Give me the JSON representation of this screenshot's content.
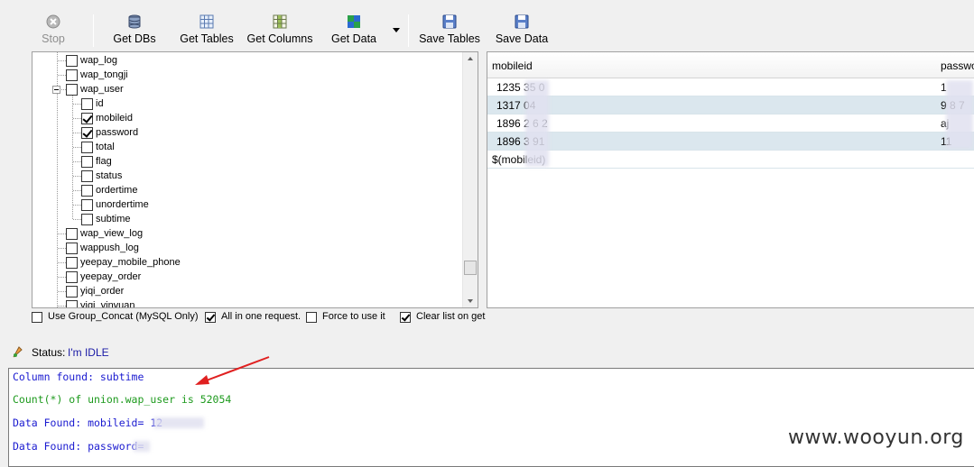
{
  "toolbar": {
    "stop": "Stop",
    "get_dbs": "Get DBs",
    "get_tables": "Get Tables",
    "get_columns": "Get Columns",
    "get_data": "Get Data",
    "save_tables": "Save Tables",
    "save_data": "Save Data"
  },
  "tree": {
    "items": [
      {
        "label": "wap_log",
        "checked": false
      },
      {
        "label": "wap_tongji",
        "checked": false
      },
      {
        "label": "wap_user",
        "checked": false,
        "expanded": true
      },
      {
        "label": "id",
        "checked": false
      },
      {
        "label": "mobileid",
        "checked": true
      },
      {
        "label": "password",
        "checked": true
      },
      {
        "label": "total",
        "checked": false
      },
      {
        "label": "flag",
        "checked": false
      },
      {
        "label": "status",
        "checked": false
      },
      {
        "label": "ordertime",
        "checked": false
      },
      {
        "label": "unordertime",
        "checked": false
      },
      {
        "label": "subtime",
        "checked": false
      },
      {
        "label": "wap_view_log",
        "checked": false
      },
      {
        "label": "wappush_log",
        "checked": false
      },
      {
        "label": "yeepay_mobile_phone",
        "checked": false
      },
      {
        "label": "yeepay_order",
        "checked": false
      },
      {
        "label": "yiqi_order",
        "checked": false
      },
      {
        "label": "yiqi_yinyuan",
        "checked": false
      }
    ]
  },
  "grid": {
    "columns": [
      "mobileid",
      "passwo"
    ],
    "rows": [
      [
        "1235    35    0",
        "1"
      ],
      [
        "1317    04    ",
        "9    8    7"
      ],
      [
        "1896    2    6    2",
        "aj"
      ],
      [
        "1896    3    91",
        "11"
      ],
      [
        "$(mobileid)",
        ""
      ]
    ]
  },
  "options": {
    "group_concat": {
      "label": "Use Group_Concat (MySQL Only)",
      "checked": false
    },
    "all_in_one": {
      "label": "All in one request.",
      "checked": true
    },
    "force": {
      "label": "Force to use it",
      "checked": false
    },
    "clear_list": {
      "label": "Clear list on get",
      "checked": true
    }
  },
  "status": {
    "label": "Status:",
    "value": "I'm IDLE"
  },
  "log": [
    {
      "text": "Column found: subtime",
      "color": "blue"
    },
    {
      "text": "Count(*) of union.wap_user is 52054",
      "color": "green"
    },
    {
      "text": "Data Found: mobileid= 12",
      "color": "blue"
    },
    {
      "text": "Data Found: password=",
      "color": "blue"
    }
  ],
  "watermark": "www.wooyun.org",
  "colors": {
    "log_blue": "#1a1ad0",
    "log_green": "#1d9a1d",
    "annotation_arrow": "#e02020",
    "row_highlight": "#dbe7ee"
  }
}
